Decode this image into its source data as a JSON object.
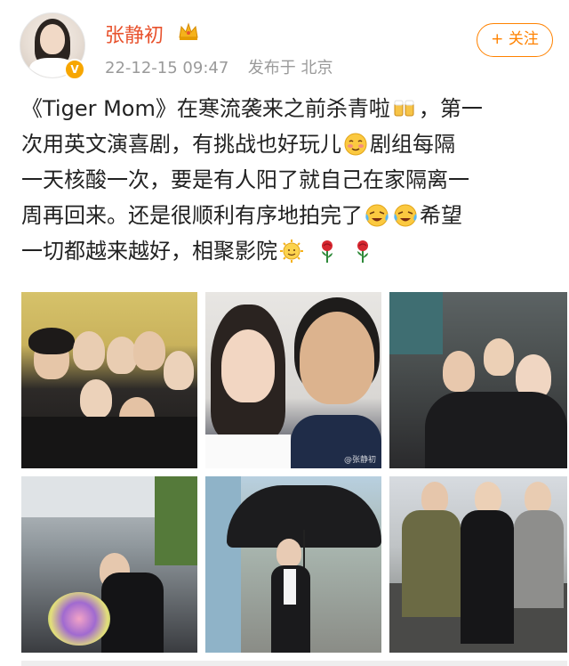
{
  "post": {
    "username": "张静初",
    "timestamp": "22-12-15 09:47",
    "location": "发布于 北京",
    "follow_label": "+ 关注",
    "text_lines": [
      "《Tiger Mom》在寒流袭来之前杀青啦",
      "，第一",
      "次用英文演喜剧，有挑战也好玩儿",
      "剧组每隔",
      "一天核酸一次，要是有人阳了就自己在家隔离一",
      "周再回来。还是很顺利有序地拍完了",
      "希望",
      "一切都越来越好，相聚影院"
    ],
    "photo_watermark": "@张静初"
  },
  "icons": {
    "crown": "crown-icon",
    "verified": "verified-badge-icon",
    "beer": "beer-cheers-emoji",
    "blush": "blush-emoji",
    "tears": "tears-of-joy-emoji",
    "sun": "sun-emoji",
    "rose": "rose-emoji"
  },
  "colors": {
    "username": "#e8522d",
    "follow": "#ff8200",
    "meta": "#9a9a9a",
    "verified": "#f7a600"
  }
}
